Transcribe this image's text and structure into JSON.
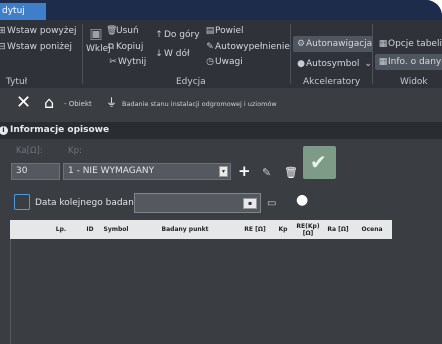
{
  "titlebar": {
    "active_tab": "dytuj"
  },
  "ribbon": {
    "row1": {
      "wstaw_powyzej": "Wstaw powyżej",
      "usun": "Usuń",
      "do_gory": "Do góry",
      "powiel": "Powiel",
      "autonawigacja": "Autonawigacja",
      "opcje_tabeli": "Opcje tabeli"
    },
    "row2": {
      "wstaw_ponizej": "Wstaw poniżej",
      "kopiuj": "Kopiuj",
      "w_dol": "W dół",
      "autowypelnienie": "Autowypełnienie",
      "autosymbol": "Autosymbol",
      "info_o_danych": "Info. o danych"
    },
    "row3": {
      "wytnij": "Wytnij",
      "uwagi": "Uwagi"
    },
    "wklej": "Wklej",
    "groups": {
      "tytul": "Tytuł",
      "edycja": "Edycja",
      "akceleratory": "Akceleratory",
      "widok": "Widok"
    }
  },
  "toolbar": {
    "breadcrumb_obiekt": "- Obiekt",
    "breadcrumb_badanie": "Badanie stanu instalacji odgromowej i uziomów"
  },
  "section": {
    "title": "Informacje opisowe"
  },
  "form": {
    "ka_label": "Ka[Ω]:",
    "kp_label": "Kp:",
    "ka_value": "30",
    "kp_value": "1 - NIE WYMAGANY",
    "next_date_label": "Data kolejnego badania:",
    "next_date_value": ""
  },
  "table": {
    "columns": [
      {
        "label": "Lp."
      },
      {
        "label": "ID"
      },
      {
        "label": "Symbol"
      },
      {
        "label": "Badany punkt"
      },
      {
        "label": "RE [Ω]"
      },
      {
        "label": "Kp"
      },
      {
        "label": "RE(Kp) [Ω]"
      },
      {
        "label": "Ra [Ω]"
      },
      {
        "label": "Ocena"
      }
    ],
    "rows": []
  },
  "colors": {
    "accent": "#3f7fc9",
    "confirm": "#7d9b86",
    "panel": "#3a3d42",
    "titlebar": "#1c2c4a"
  },
  "icons": [
    "close-icon",
    "home-icon",
    "ground-icon",
    "info-icon",
    "plus-icon",
    "edit-icon",
    "trash-icon",
    "check-icon",
    "calendar-icon",
    "map-pin-icon"
  ]
}
